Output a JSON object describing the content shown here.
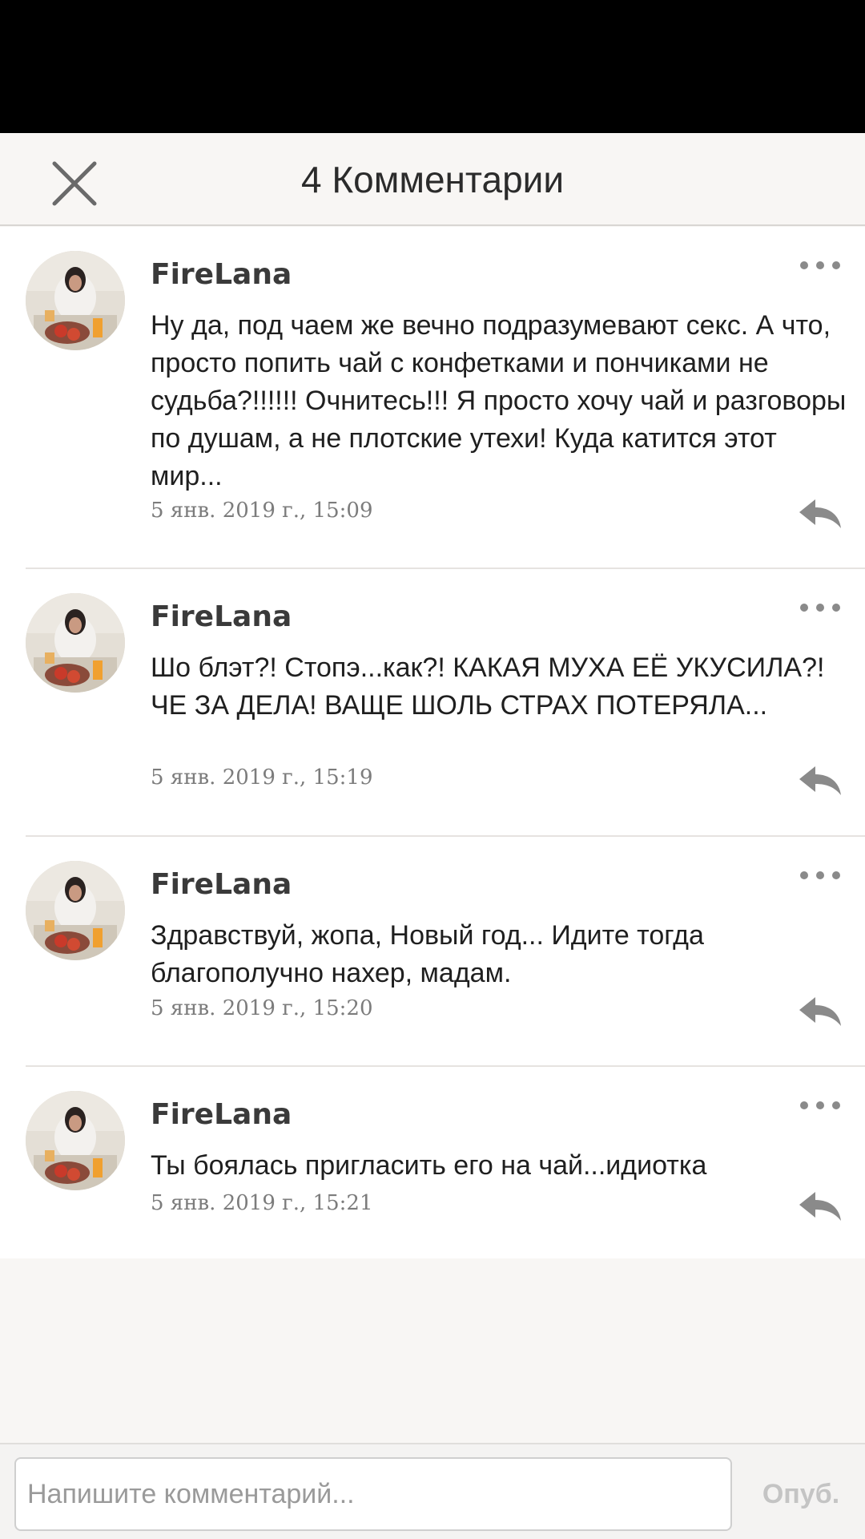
{
  "header": {
    "title": "4 Комментарии",
    "close_icon": "close-icon"
  },
  "comments": [
    {
      "author": "FireLana",
      "text": "Ну да, под чаем же вечно подразумевают секс. А что, просто попить чай с конфетками и пончиками не судьба?!!!!!! Очнитесь!!! Я просто хочу чай и разговоры по душам, а не плотские утехи! Куда катится этот мир...",
      "timestamp": "5 янв. 2019 г., 15:09"
    },
    {
      "author": "FireLana",
      "text": "Шо блэт?! Стопэ...как?! КАКАЯ МУХА ЕЁ УКУСИЛА?! ЧЕ ЗА ДЕЛА! ВАЩЕ ШОЛЬ СТРАХ ПОТЕРЯЛА...",
      "timestamp": "5 янв. 2019 г., 15:19"
    },
    {
      "author": "FireLana",
      "text": "Здравствуй, жопа, Новый год... Идите тогда благополучно нахер, мадам.",
      "timestamp": "5 янв. 2019 г., 15:20"
    },
    {
      "author": "FireLana",
      "text": "Ты боялась пригласить его на чай...идиотка",
      "timestamp": "5 янв. 2019 г., 15:21"
    }
  ],
  "compose": {
    "placeholder": "Напишите комментарий...",
    "value": "",
    "publish_label": "Опуб."
  },
  "colors": {
    "background": "#f8f6f4",
    "list_background": "#ffffff",
    "icon_gray": "#8a8a8a",
    "publish_disabled": "#c4c4c4"
  }
}
